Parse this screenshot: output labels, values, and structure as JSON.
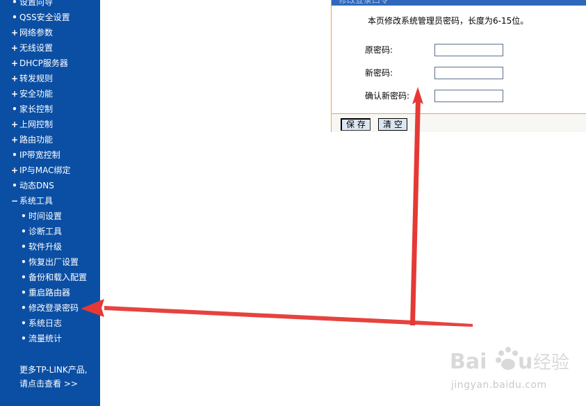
{
  "sidebar": {
    "items": [
      {
        "marker": "•",
        "label": "设置向导",
        "level": "top"
      },
      {
        "marker": "•",
        "label": "QSS安全设置",
        "level": "top"
      },
      {
        "marker": "+",
        "label": "网络参数",
        "level": "top"
      },
      {
        "marker": "+",
        "label": "无线设置",
        "level": "top"
      },
      {
        "marker": "+",
        "label": "DHCP服务器",
        "level": "top"
      },
      {
        "marker": "+",
        "label": "转发规则",
        "level": "top"
      },
      {
        "marker": "+",
        "label": "安全功能",
        "level": "top"
      },
      {
        "marker": "•",
        "label": "家长控制",
        "level": "top"
      },
      {
        "marker": "+",
        "label": "上网控制",
        "level": "top"
      },
      {
        "marker": "+",
        "label": "路由功能",
        "level": "top"
      },
      {
        "marker": "•",
        "label": "IP带宽控制",
        "level": "top"
      },
      {
        "marker": "+",
        "label": "IP与MAC绑定",
        "level": "top"
      },
      {
        "marker": "•",
        "label": "动态DNS",
        "level": "top"
      },
      {
        "marker": "−",
        "label": "系统工具",
        "level": "top"
      },
      {
        "marker": "•",
        "label": "时间设置",
        "level": "sub"
      },
      {
        "marker": "•",
        "label": "诊断工具",
        "level": "sub"
      },
      {
        "marker": "•",
        "label": "软件升级",
        "level": "sub"
      },
      {
        "marker": "•",
        "label": "恢复出厂设置",
        "level": "sub"
      },
      {
        "marker": "•",
        "label": "备份和载入配置",
        "level": "sub"
      },
      {
        "marker": "•",
        "label": "重启路由器",
        "level": "sub"
      },
      {
        "marker": "•",
        "label": "修改登录密码",
        "level": "sub"
      },
      {
        "marker": "•",
        "label": "系统日志",
        "level": "sub"
      },
      {
        "marker": "•",
        "label": "流量统计",
        "level": "sub"
      }
    ],
    "promo_line1": "更多TP-LINK产品,",
    "promo_line2": "请点击查看 >>"
  },
  "panel": {
    "header_text": "修改登录口令",
    "intro": "本页修改系统管理员密码，长度为6-15位。",
    "fields": {
      "old_password_label": "原密码:",
      "new_password_label": "新密码:",
      "confirm_password_label": "确认新密码:"
    },
    "save_label": "保 存",
    "clear_label": "清 空"
  },
  "watermark": {
    "url": "jingyan.baidu.com"
  },
  "colors": {
    "sidebar_bg": "#0b4fa4",
    "panel_border": "#f0a34a",
    "panel_header": "#2f68bb",
    "arrow": "#e53935"
  }
}
